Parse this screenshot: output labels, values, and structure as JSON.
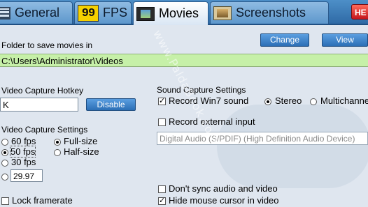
{
  "tabs": [
    {
      "label": "General",
      "icon": "general-icon"
    },
    {
      "label": "FPS",
      "icon_text": "99",
      "icon": "fps-icon"
    },
    {
      "label": "Movies",
      "icon": "movies-icon"
    },
    {
      "label": "Screenshots",
      "icon": "screenshots-icon"
    }
  ],
  "active_tab": "Movies",
  "help_button": "HE",
  "folder": {
    "label": "Folder to save movies in",
    "path": "C:\\Users\\Administrator\\Videos",
    "change_label": "Change",
    "view_label": "View"
  },
  "hotkey": {
    "label": "Video Capture Hotkey",
    "value": "K",
    "disable_label": "Disable"
  },
  "video_settings": {
    "label": "Video Capture Settings",
    "fps_options": [
      "60 fps",
      "50 fps",
      "30 fps"
    ],
    "selected_fps": "50 fps",
    "custom_fps": "29.97",
    "size_options": [
      "Full-size",
      "Half-size"
    ],
    "selected_size": "Full-size",
    "lock_framerate": "Lock framerate"
  },
  "sound": {
    "label": "Sound Capture Settings",
    "record_win7": "Record Win7 sound",
    "record_win7_checked": true,
    "channel_options": [
      "Stereo",
      "Multichannel"
    ],
    "selected_channel": "Stereo",
    "record_external": "Record external input",
    "record_external_checked": false,
    "device": "Digital Audio (S/PDIF) (High Definition Audio Device)",
    "dont_sync": "Don't sync audio and video",
    "dont_sync_checked": false,
    "hide_cursor": "Hide mouse cursor in video",
    "hide_cursor_checked": true
  },
  "watermark": "www.PaldaBook.com"
}
